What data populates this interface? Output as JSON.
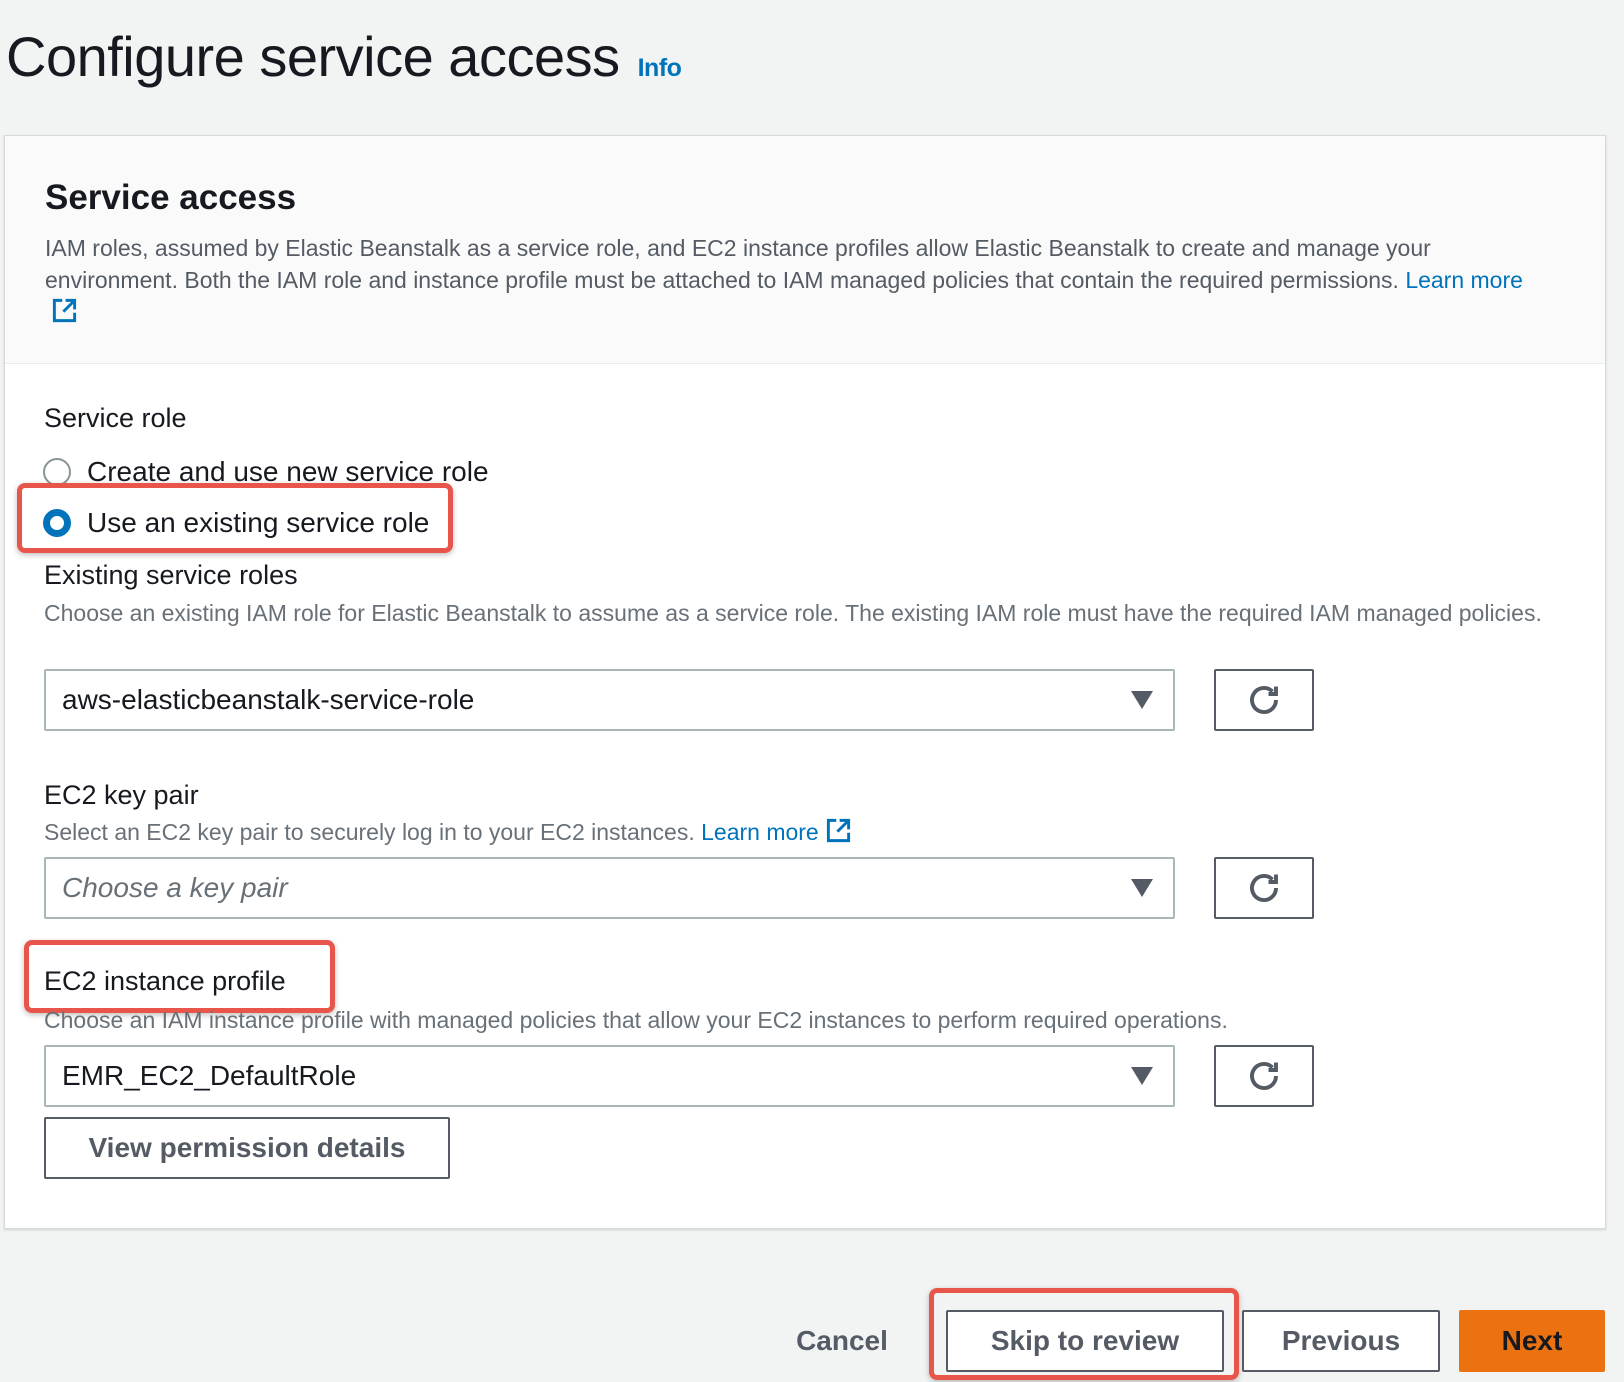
{
  "page": {
    "title": "Configure service access",
    "info_label": "Info"
  },
  "service_access": {
    "title": "Service access",
    "description": "IAM roles, assumed by Elastic Beanstalk as a service role, and EC2 instance profiles allow Elastic Beanstalk to create and manage your environment. Both the IAM role and instance profile must be attached to IAM managed policies that contain the required permissions.",
    "learn_more": "Learn more"
  },
  "service_role": {
    "label": "Service role",
    "options": [
      {
        "label": "Create and use new service role",
        "selected": false
      },
      {
        "label": "Use an existing service role",
        "selected": true
      }
    ]
  },
  "existing_roles": {
    "label": "Existing service roles",
    "description": "Choose an existing IAM role for Elastic Beanstalk to assume as a service role. The existing IAM role must have the required IAM managed policies.",
    "value": "aws-elasticbeanstalk-service-role"
  },
  "key_pair": {
    "label": "EC2 key pair",
    "description": "Select an EC2 key pair to securely log in to your EC2 instances.",
    "learn_more": "Learn more",
    "placeholder": "Choose a key pair"
  },
  "instance_profile": {
    "label": "EC2 instance profile",
    "description": "Choose an IAM instance profile with managed policies that allow your EC2 instances to perform required operations.",
    "value": "EMR_EC2_DefaultRole",
    "view_permissions": "View permission details"
  },
  "footer": {
    "cancel": "Cancel",
    "skip": "Skip to review",
    "previous": "Previous",
    "next": "Next"
  },
  "colors": {
    "accent": "#0073bb",
    "primary_button": "#ec7211",
    "highlight": "#e8564b"
  }
}
